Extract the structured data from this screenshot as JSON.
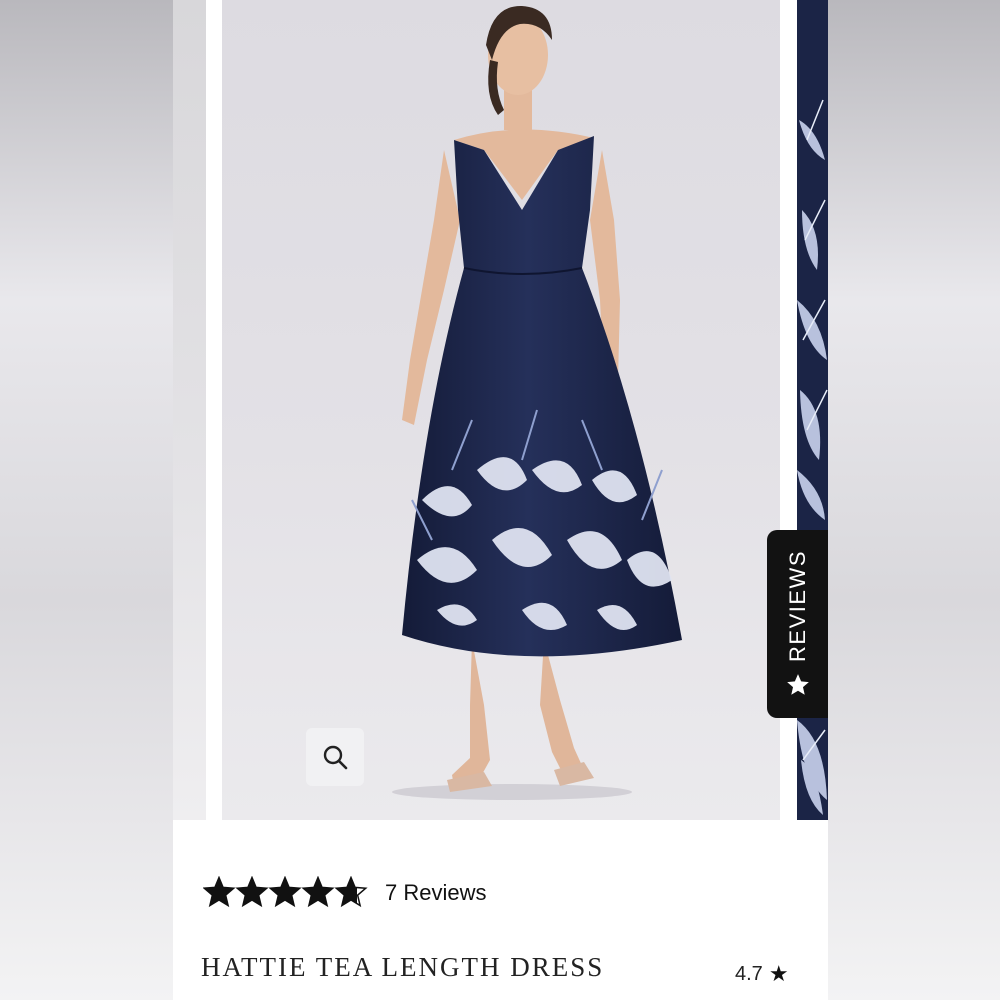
{
  "colors": {
    "dress_navy": "#1b2446",
    "tab_bg": "#121212",
    "star_fill": "#111111",
    "background": "#e6e5e8"
  },
  "images": {
    "main": "woman in navy sleeveless tea-length dress with white floral hem, nude heels",
    "side": "close-up of navy and white floral print"
  },
  "icons": {
    "zoom": "magnifier-icon",
    "tab_star": "star-icon"
  },
  "reviews_tab": {
    "label": "REVIEWS"
  },
  "rating_summary": {
    "stars_value": 4.7,
    "stars_max": 5,
    "count_label": "7 Reviews"
  },
  "product": {
    "title": "HATTIE TEA LENGTH DRESS",
    "rating_text": "4.7",
    "rating_star": "★"
  }
}
